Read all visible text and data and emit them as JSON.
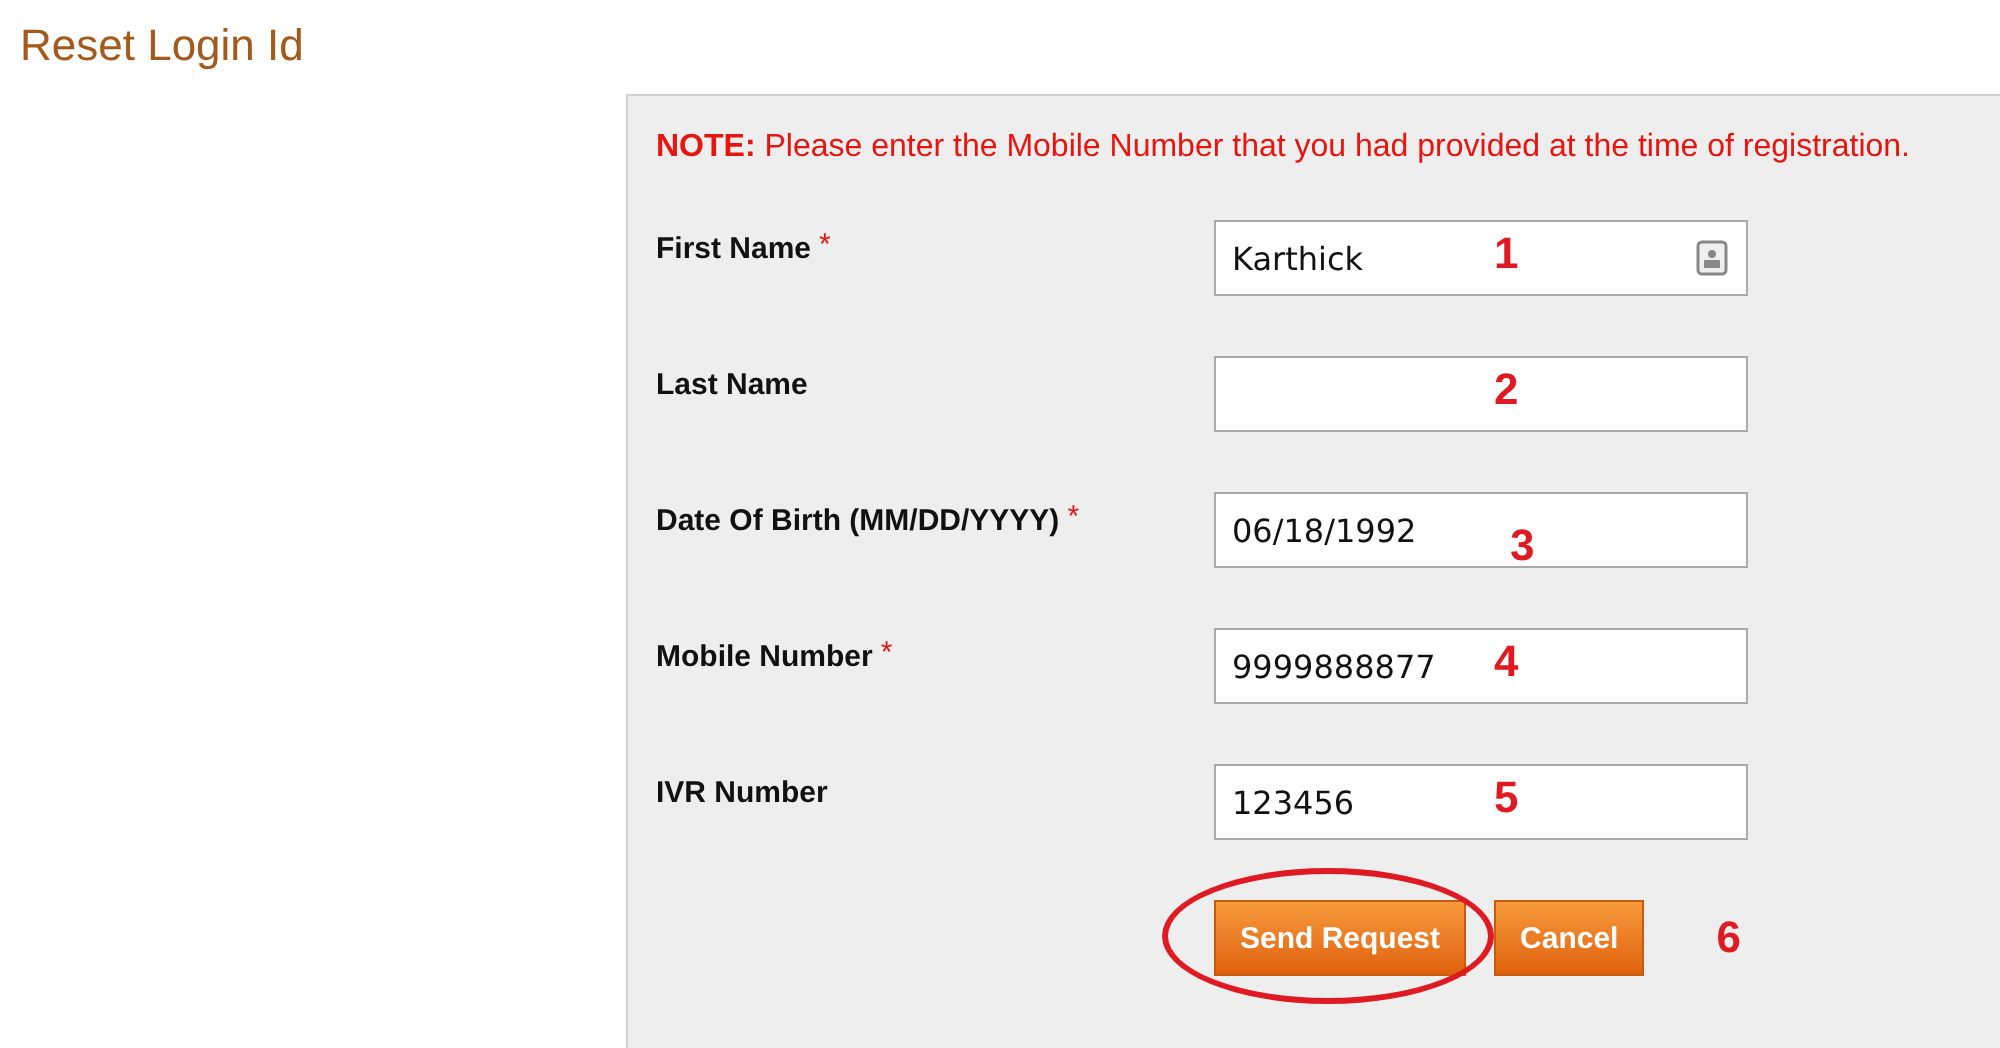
{
  "page": {
    "title": "Reset Login Id"
  },
  "note": {
    "label": "NOTE:",
    "text": "Please enter the Mobile Number that you had provided at the time of registration."
  },
  "fields": [
    {
      "label": "First Name",
      "required_mark": "*",
      "value": "Karthick",
      "contact_icon": true,
      "annotation": "1"
    },
    {
      "label": "Last Name",
      "annotation": "2"
    },
    {
      "label": "Date Of Birth (MM/DD/YYYY)",
      "required_mark": "*",
      "value": "06/18/1992",
      "annotation": "3"
    },
    {
      "label": "Mobile Number",
      "required_mark": "*",
      "value": "9999888877",
      "annotation": "4"
    },
    {
      "label": "IVR Number",
      "value": "123456",
      "annotation": "5"
    }
  ],
  "buttons": [
    {
      "label": "Send Request",
      "circled": true
    },
    {
      "label": "Cancel",
      "circled": false
    }
  ],
  "buttons_annotation": "6"
}
